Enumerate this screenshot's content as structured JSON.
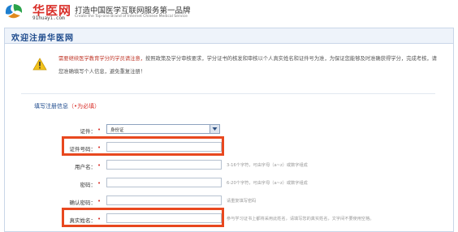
{
  "header": {
    "logo_cn": "华医网",
    "logo_en": "91huayi.com",
    "slogan": "打造中国医学互联网服务第一品牌",
    "slogan_en": "Create the Top-one Brand of Internet Chinese Medical Service"
  },
  "panel": {
    "title": "欢迎注册华医网"
  },
  "notice": {
    "highlight": "需要继续医学教育学分的学员请注意，",
    "text": "按照政策及学分审核要求，学分证书的核发和审核以个人真实姓名和证件号为准，为保证您能够及时准确获得学分，完成考核，请您准确填写个人信息，避免重复注册！"
  },
  "form": {
    "section_label": "填写注册信息",
    "section_req_note": "（•为必填）",
    "fields": [
      {
        "label": "证件：",
        "star": "•",
        "type": "select",
        "value": "身份证",
        "hint": ""
      },
      {
        "label": "证件号码：",
        "star": "•",
        "type": "input",
        "value": "",
        "hint": ""
      },
      {
        "label": "用户名：",
        "star": "•",
        "type": "input",
        "value": "",
        "hint": "3-16个字符，可由字母（a~z）或数字组成"
      },
      {
        "label": "密码：",
        "star": "•",
        "type": "input",
        "value": "",
        "hint": "6-20个字符，可由字母（a~z）或数字组成"
      },
      {
        "label": "确认密码：",
        "star": "•",
        "type": "input",
        "value": "",
        "hint": "请重复填写密码"
      },
      {
        "label": "真实姓名：",
        "star": "•",
        "type": "input",
        "value": "",
        "hint": "参与学习证书上都将采用此姓名，请填写您的真实姓名，文字间不要使用空格。"
      }
    ]
  },
  "colors": {
    "brand_red": "#d9302a",
    "title_blue": "#1d4a8c",
    "highlight_box": "#e8481f"
  }
}
